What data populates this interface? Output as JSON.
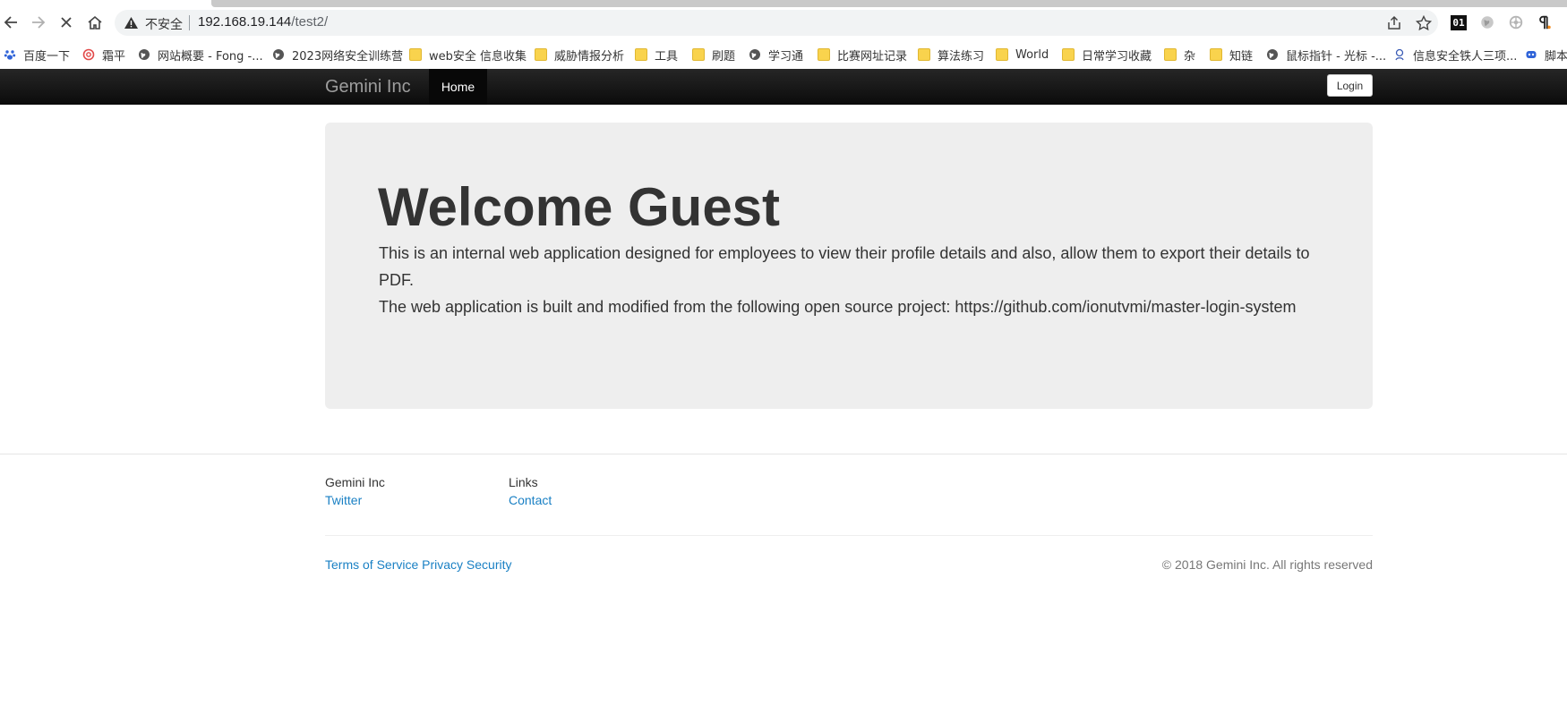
{
  "browser": {
    "address": {
      "security_label": "不安全",
      "host": "192.168.19.144",
      "path": "/test2/"
    },
    "extensions": {
      "ext1_label": "01"
    },
    "bookmarks": [
      {
        "label": "百度一下",
        "icon": "paw-icon"
      },
      {
        "label": "霜平",
        "icon": "swirl-icon"
      },
      {
        "label": "网站概要 - Fong -...",
        "icon": "globe-icon"
      },
      {
        "label": "2023网络安全训练营",
        "icon": "none"
      },
      {
        "label": "web安全 信息收集",
        "icon": "folder-icon"
      },
      {
        "label": "威胁情报分析",
        "icon": "folder-icon"
      },
      {
        "label": "工具",
        "icon": "folder-icon"
      },
      {
        "label": "刷题",
        "icon": "folder-icon"
      },
      {
        "label": "学习通",
        "icon": "globe-icon"
      },
      {
        "label": "比赛网址记录",
        "icon": "folder-icon"
      },
      {
        "label": "算法练习",
        "icon": "folder-icon"
      },
      {
        "label": "World",
        "icon": "folder-icon"
      },
      {
        "label": "日常学习收藏",
        "icon": "folder-icon"
      },
      {
        "label": "杂",
        "icon": "folder-icon"
      },
      {
        "label": "知链",
        "icon": "folder-icon"
      },
      {
        "label": "鼠标指针 - 光标 -...",
        "icon": "globe-icon"
      },
      {
        "label": "信息安全铁人三项...",
        "icon": "mascot-icon"
      },
      {
        "label": "脚本",
        "icon": "robot-icon"
      }
    ]
  },
  "navbar": {
    "brand": "Gemini Inc",
    "home_label": "Home",
    "login_label": "Login"
  },
  "jumbotron": {
    "heading": "Welcome Guest",
    "paragraph1": "This is an internal web application designed for employees to view their profile details and also, allow them to export their details to PDF.",
    "paragraph2": "The web application is built and modified from the following open source project: https://github.com/ionutvmi/master-login-system"
  },
  "footer": {
    "col1_title": "Gemini Inc",
    "col1_link": "Twitter",
    "col2_title": "Links",
    "col2_link": "Contact",
    "legal_links": "Terms of Service Privacy Security",
    "copyright": "© 2018 Gemini Inc. All rights reserved"
  },
  "colors": {
    "link": "#1a80c4",
    "navbar_bg": "#0b0b0b",
    "jumbotron_bg": "#eeeeee"
  }
}
